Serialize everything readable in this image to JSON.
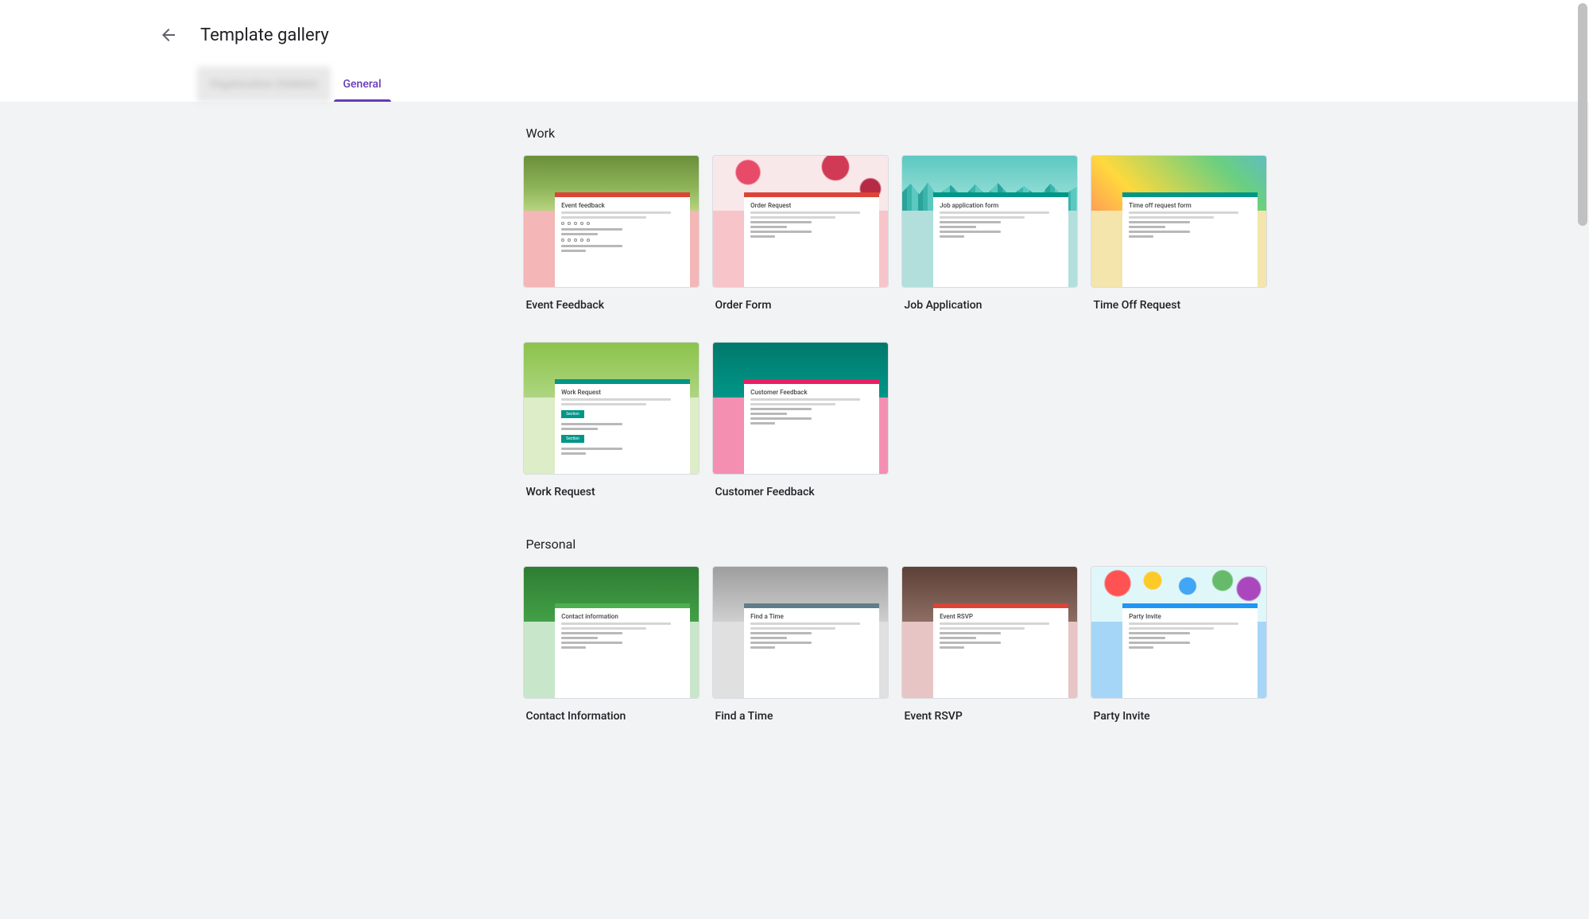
{
  "header": {
    "title": "Template gallery"
  },
  "tabs": {
    "org": "Organization (hidden)",
    "general": "General"
  },
  "sections": [
    {
      "title": "Work",
      "templates": [
        {
          "name": "Event Feedback",
          "preview_title": "Event feedback",
          "header_class": "h-event",
          "bg_class": "bg-pink",
          "accent": "#db4437"
        },
        {
          "name": "Order Form",
          "preview_title": "Order Request",
          "header_class": "h-order",
          "bg_class": "bg-lpink",
          "accent": "#db4437"
        },
        {
          "name": "Job Application",
          "preview_title": "Job application form",
          "header_class": "h-job",
          "bg_class": "bg-teal",
          "accent": "#009688"
        },
        {
          "name": "Time Off Request",
          "preview_title": "Time off request form",
          "header_class": "h-time",
          "bg_class": "bg-yellow",
          "accent": "#009688"
        },
        {
          "name": "Work Request",
          "preview_title": "Work Request",
          "header_class": "h-workreq",
          "bg_class": "bg-lime",
          "accent": "#009688"
        },
        {
          "name": "Customer Feedback",
          "preview_title": "Customer Feedback",
          "header_class": "h-custfb",
          "bg_class": "bg-hotpink",
          "accent": "#e91e63"
        }
      ]
    },
    {
      "title": "Personal",
      "templates": [
        {
          "name": "Contact Information",
          "preview_title": "Contact information",
          "header_class": "h-contact",
          "bg_class": "bg-lgreen",
          "accent": "#4caf50"
        },
        {
          "name": "Find a Time",
          "preview_title": "Find a Time",
          "header_class": "h-findtime",
          "bg_class": "bg-grey",
          "accent": "#607d8b"
        },
        {
          "name": "Event RSVP",
          "preview_title": "Event RSVP",
          "header_class": "h-rsvp",
          "bg_class": "bg-rsvp",
          "accent": "#db4437"
        },
        {
          "name": "Party Invite",
          "preview_title": "Party Invite",
          "header_class": "h-party",
          "bg_class": "bg-blue",
          "accent": "#2196f3"
        }
      ]
    }
  ]
}
